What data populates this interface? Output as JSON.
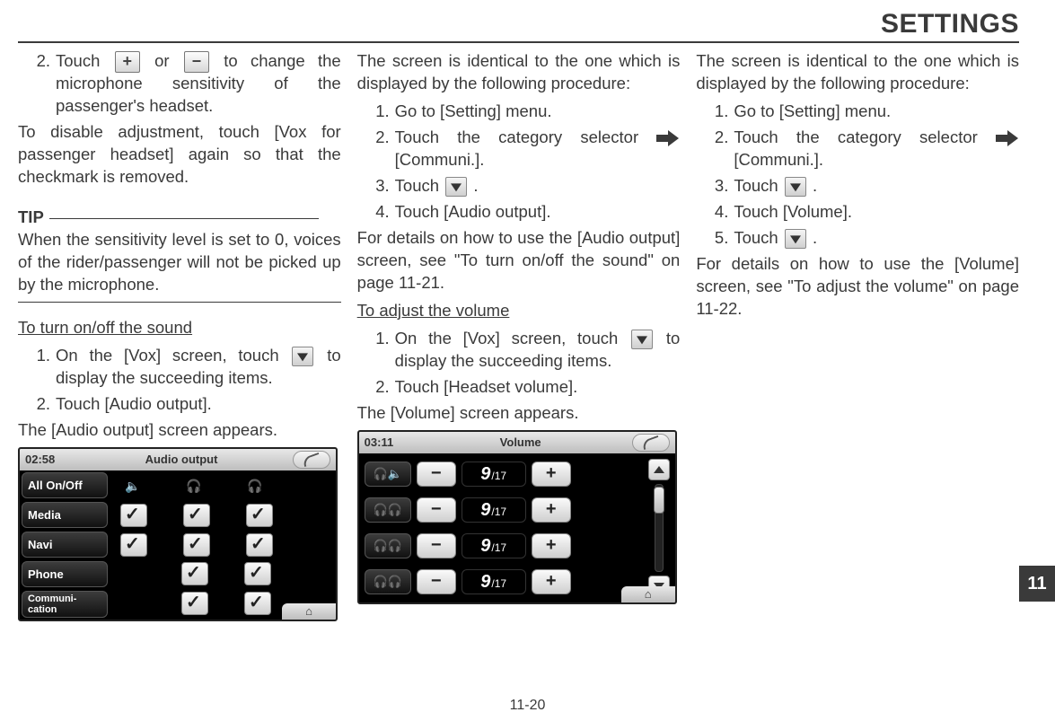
{
  "header": "SETTINGS",
  "page_number": "11-20",
  "side_tab": "11",
  "col1": {
    "step2_pre": "Touch",
    "plus": "+",
    "minus": "−",
    "step2_mid": "or",
    "step2_post": "to change the microphone sensitivity of the passenger's headset.",
    "step2_sub": "To disable adjustment, touch [Vox for passenger headset] again so that the checkmark is removed.",
    "tip_label": "TIP",
    "tip_text": "When the sensitivity level is set to 0, voices of the rider/passenger will not be picked up by the microphone.",
    "subhead": "To turn on/off the sound",
    "s1_pre": "On the [Vox] screen, touch",
    "s1_post": "to display the succeeding items.",
    "s2": "Touch [Audio output].",
    "s2_sub": "The [Audio output] screen appears."
  },
  "audio_shot": {
    "time": "02:58",
    "title": "Audio output",
    "rows": [
      "All On/Off",
      "Media",
      "Navi",
      "Phone",
      "Communi-\ncation"
    ]
  },
  "col2": {
    "intro": "The screen is identical to the one which is displayed by the following procedure:",
    "s1": "Go to [Setting] menu.",
    "s2_pre": "Touch the category selector",
    "s2_post": " [Communi.].",
    "s3_pre": "Touch",
    "s3_post": ".",
    "s4": "Touch [Audio output].",
    "details": "For details on how to use the [Audio output] screen, see \"To turn on/off the sound\" on page 11-21.",
    "subhead": "To adjust the volume",
    "v1_pre": "On the [Vox] screen, touch",
    "v1_post": "to display the succeeding items.",
    "v2": "Touch [Headset volume].",
    "v2_sub": "The [Volume] screen appears."
  },
  "vol_shot": {
    "time": "03:11",
    "title": "Volume",
    "value_big": "9",
    "value_small": "/17"
  },
  "col3": {
    "intro": "The screen is identical to the one which is displayed by the following procedure:",
    "s1": "Go to [Setting] menu.",
    "s2_pre": "Touch the category selector",
    "s2_post": " [Communi.].",
    "s3_pre": "Touch",
    "s3_post": ".",
    "s4": "Touch [Volume].",
    "s5_pre": "Touch",
    "s5_post": ".",
    "details": "For details on how to use the [Volume] screen, see \"To adjust the volume\" on page 11-22."
  }
}
